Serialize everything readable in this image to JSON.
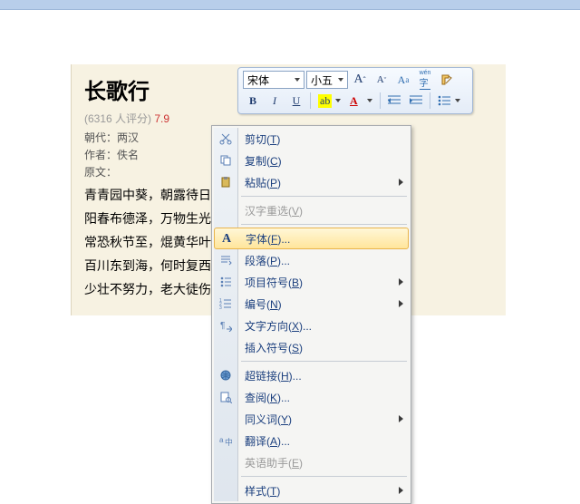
{
  "document": {
    "title": "长歌行",
    "rating_count_text": "(6316 人评分)",
    "rating_score": "7.9",
    "dynasty_label": "朝代：",
    "dynasty": "两汉",
    "author_label": "作者：",
    "author": "佚名",
    "source_label": "原文：",
    "lines": [
      "青青园中葵，朝露待日晞。",
      "阳春布德泽，万物生光辉。",
      "常恐秋节至，焜黄华叶衰。",
      "百川东到海，何时复西归？",
      "少壮不努力，老大徒伤悲！"
    ]
  },
  "toolbar": {
    "font_name": "宋体",
    "font_size": "小五",
    "grow_font": "A",
    "shrink_font": "A",
    "bold": "B",
    "italic": "I",
    "underline": "U",
    "highlight": "ab",
    "font_color": "A"
  },
  "context_menu": {
    "items": [
      {
        "id": "cut",
        "label": "剪切",
        "accel": "T",
        "icon": "cut"
      },
      {
        "id": "copy",
        "label": "复制",
        "accel": "C",
        "icon": "copy"
      },
      {
        "id": "paste",
        "label": "粘贴",
        "accel": "P",
        "icon": "paste",
        "submenu": true
      },
      {
        "id": "sep"
      },
      {
        "id": "reselect",
        "label": "汉字重选",
        "accel": "V",
        "disabled": true
      },
      {
        "id": "sep"
      },
      {
        "id": "font",
        "label": "字体",
        "accel": "F",
        "suffix": "...",
        "icon": "font",
        "highlight": true
      },
      {
        "id": "paragraph",
        "label": "段落",
        "accel": "P",
        "suffix": "...",
        "icon": "para"
      },
      {
        "id": "bullets",
        "label": "项目符号",
        "accel": "B",
        "icon": "bullets",
        "submenu": true
      },
      {
        "id": "numbering",
        "label": "编号",
        "accel": "N",
        "icon": "numbering",
        "submenu": true
      },
      {
        "id": "direction",
        "label": "文字方向",
        "accel": "X",
        "suffix": "...",
        "icon": "dir"
      },
      {
        "id": "symbol",
        "label": "插入符号",
        "accel": "S"
      },
      {
        "id": "sep"
      },
      {
        "id": "hyperlink",
        "label": "超链接",
        "accel": "H",
        "suffix": "...",
        "icon": "link"
      },
      {
        "id": "lookup",
        "label": "查阅",
        "accel": "K",
        "suffix": "...",
        "icon": "lookup"
      },
      {
        "id": "thesaurus",
        "label": "同义词",
        "accel": "Y",
        "submenu": true
      },
      {
        "id": "translate",
        "label": "翻译",
        "accel": "A",
        "suffix": "...",
        "icon": "translate"
      },
      {
        "id": "engassist",
        "label": "英语助手",
        "accel": "E",
        "disabled": true
      },
      {
        "id": "sep"
      },
      {
        "id": "styles",
        "label": "样式",
        "accel": "T",
        "submenu": true
      }
    ]
  }
}
